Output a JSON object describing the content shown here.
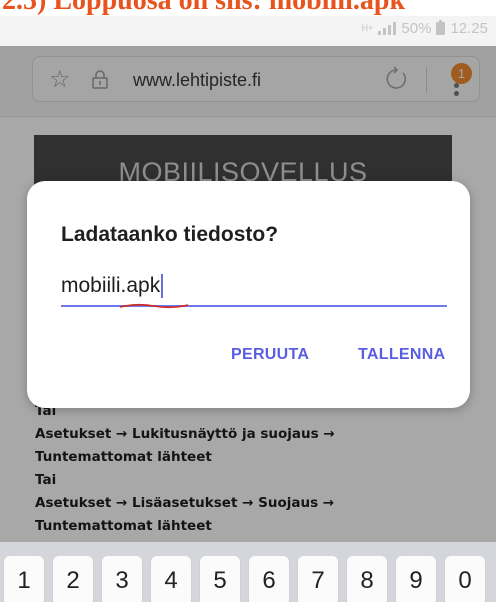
{
  "caption": {
    "text": "2.5) Loppuosa on siis: mobiili.apk"
  },
  "status_bar": {
    "network": "H+",
    "battery": "50%",
    "time": "12.25"
  },
  "browser": {
    "url": "www.lehtipiste.fi",
    "notification_count": "1",
    "icons": [
      "star-icon",
      "lock-icon",
      "reload-icon",
      "menu-icon"
    ]
  },
  "page": {
    "banner": "MOBIILISOVELLUS",
    "lines": [
      "Tai",
      "Asetukset → Lukitusnäyttö ja suojaus →",
      "Tuntemattomat lähteet",
      "Tai",
      "Asetukset → Lisäasetukset → Suojaus →",
      "Tuntemattomat lähteet"
    ]
  },
  "dialog": {
    "title": "Ladataanko tiedosto?",
    "filename": "mobiili.apk",
    "cancel_label": "PERUUTA",
    "save_label": "TALLENNA"
  },
  "keyboard": {
    "keys": [
      "1",
      "2",
      "3",
      "4",
      "5",
      "6",
      "7",
      "8",
      "9",
      "0"
    ]
  },
  "colors": {
    "accent": "#5a5ee0",
    "caption": "#e8541e",
    "badge": "#f08c2e",
    "banner": "#4a4a4a"
  }
}
